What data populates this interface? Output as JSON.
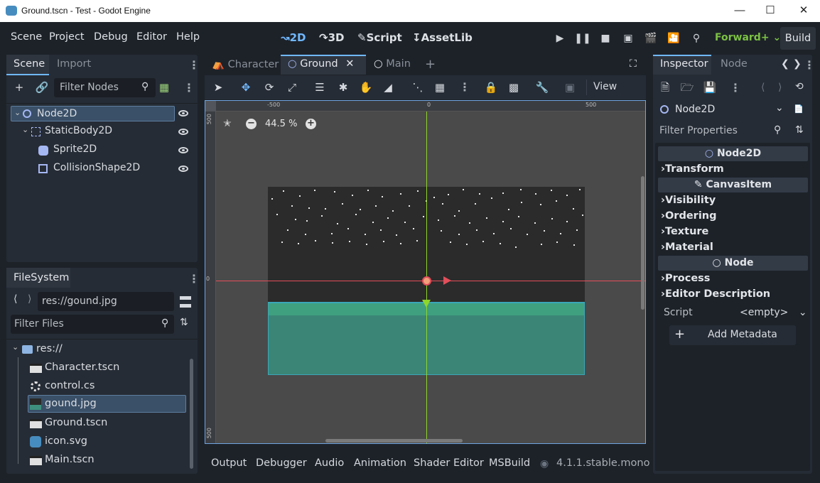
{
  "window": {
    "title": "Ground.tscn - Test - Godot Engine"
  },
  "menu": [
    "Scene",
    "Project",
    "Debug",
    "Editor",
    "Help"
  ],
  "workspaces": [
    "2D",
    "3D",
    "Script",
    "AssetLib"
  ],
  "renderer": "Forward+",
  "build_label": "Build",
  "scene_dock": {
    "tabs": [
      "Scene",
      "Import"
    ],
    "filter_placeholder": "Filter Nodes",
    "nodes": [
      "Node2D",
      "StaticBody2D",
      "Sprite2D",
      "CollisionShape2D"
    ]
  },
  "filesystem_dock": {
    "tab": "FileSystem",
    "path": "res://gound.jpg",
    "filter_placeholder": "Filter Files",
    "root": "res://",
    "files": [
      "Character.tscn",
      "control.cs",
      "gound.jpg",
      "Ground.tscn",
      "icon.svg",
      "Main.tscn"
    ]
  },
  "editor_tabs": [
    "Character",
    "Ground",
    "Main"
  ],
  "toolbar": {
    "view_label": "View"
  },
  "viewport": {
    "zoom": "44.5 %",
    "ruler_top": [
      "-500",
      "0",
      "500"
    ],
    "ruler_left": [
      "500",
      "0",
      "500"
    ]
  },
  "bottom_tabs": [
    "Output",
    "Debugger",
    "Audio",
    "Animation",
    "Shader Editor",
    "MSBuild"
  ],
  "version": "4.1.1.stable.mono",
  "inspector": {
    "tabs": [
      "Inspector",
      "Node"
    ],
    "selected_node": "Node2D",
    "filter_placeholder": "Filter Properties",
    "class_header": "Node2D",
    "sections_a": [
      "Transform"
    ],
    "canvas_header": "CanvasItem",
    "sections_b": [
      "Visibility",
      "Ordering",
      "Texture",
      "Material"
    ],
    "node_header": "Node",
    "sections_c": [
      "Process",
      "Editor Description"
    ],
    "script_label": "Script",
    "script_value": "<empty>",
    "add_metadata": "Add Metadata"
  },
  "colors": {
    "accent": "#70b8ff",
    "renderer": "#7bc143",
    "x_axis": "#e24e5a",
    "y_axis": "#8ed62a"
  }
}
